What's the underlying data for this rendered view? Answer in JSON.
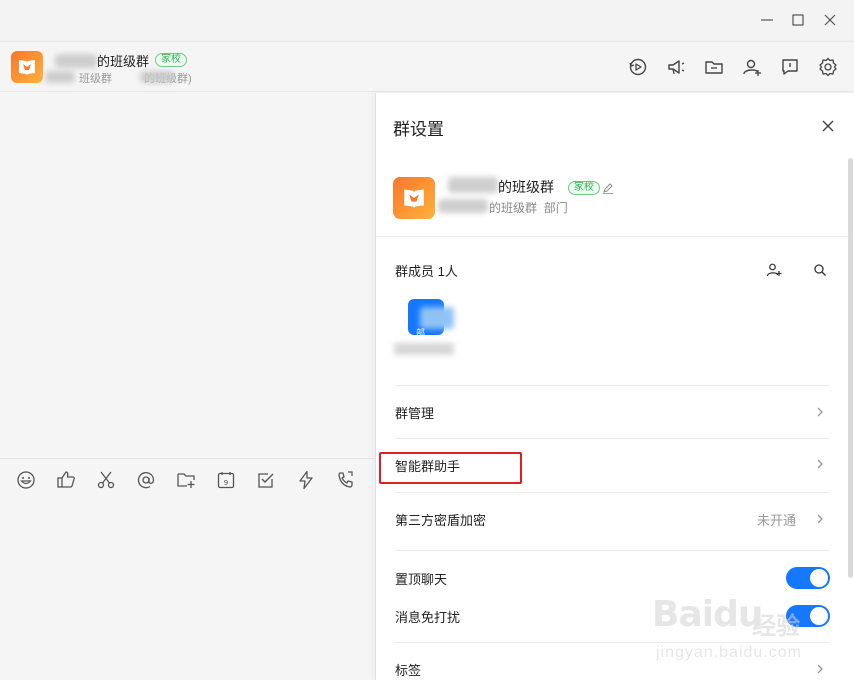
{
  "header": {
    "group_name_suffix": "的班级群",
    "badge": "家校",
    "sub_text_a": "班级群",
    "sub_text_b": "的班级群)"
  },
  "panel": {
    "title": "群设置",
    "group_name_suffix": "的班级群",
    "badge": "家校",
    "group_sub": "的班级群",
    "group_dept": "部门",
    "members_label": "群成员 1人",
    "member_initial": "部",
    "manage_label": "群管理",
    "assistant_label": "智能群助手",
    "encryption_label": "第三方密盾加密",
    "encryption_status": "未开通",
    "pin_label": "置顶聊天",
    "dnd_label": "消息免打扰",
    "tags_label": "标签"
  },
  "toggles": {
    "pin_on": true,
    "dnd_on": true
  },
  "icons": {
    "window": [
      "minimize-icon",
      "maximize-icon",
      "close-icon"
    ],
    "header": [
      "history-icon",
      "announcement-icon",
      "folder-icon",
      "add-member-icon",
      "feedback-icon",
      "settings-icon"
    ],
    "toolbar": [
      "emoji-icon",
      "like-icon",
      "screenshot-icon",
      "mention-icon",
      "add-folder-icon",
      "calendar-icon",
      "task-icon",
      "flash-icon",
      "call-icon"
    ]
  },
  "colors": {
    "accent": "#1677ff",
    "badge_green": "#2fae57",
    "highlight": "#e02020",
    "avatar_orange": "#f9762c"
  },
  "watermark": {
    "main": "Baidu",
    "cn": "经验",
    "url": "jingyan.baidu.com"
  }
}
